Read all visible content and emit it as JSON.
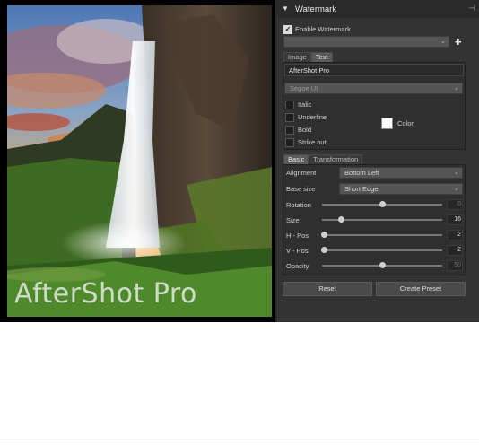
{
  "preview": {
    "watermark_text": "AfterShot Pro"
  },
  "panel": {
    "title": "Watermark",
    "enable_watermark_label": "Enable Watermark",
    "enable_watermark_checked": true,
    "preset_value": "",
    "add_label": "+",
    "tabs_top": [
      {
        "label": "Image"
      },
      {
        "label": "Text"
      }
    ],
    "text_value": "AfterShot Pro",
    "font_value": "Segoe UI",
    "styles": [
      {
        "label": "Italic",
        "checked": false
      },
      {
        "label": "Underline",
        "checked": false
      },
      {
        "label": "Bold",
        "checked": false
      },
      {
        "label": "Strike out",
        "checked": false
      }
    ],
    "color_label": "Color",
    "color_value": "#ffffff",
    "tabs_bottom": [
      {
        "label": "Basic"
      },
      {
        "label": "Transformation"
      }
    ],
    "alignment_label": "Alignment",
    "alignment_value": "Bottom Left",
    "base_size_label": "Base size",
    "base_size_value": "Short Edge",
    "sliders": [
      {
        "label": "Rotation",
        "value": "0",
        "fraction": 0.5,
        "dim": true
      },
      {
        "label": "Size",
        "value": "16",
        "fraction": 0.16,
        "dim": false
      },
      {
        "label": "H - Pos",
        "value": "2",
        "fraction": 0.02,
        "dim": false
      },
      {
        "label": "V - Pos",
        "value": "2",
        "fraction": 0.02,
        "dim": false
      },
      {
        "label": "Opacity",
        "value": "50",
        "fraction": 0.5,
        "dim": true
      }
    ],
    "reset_label": "Reset",
    "create_preset_label": "Create Preset"
  },
  "colors": {
    "panel_bg": "#333333",
    "header_bg": "#2a2a2a",
    "accent": "#dcdcdc"
  },
  "icons": {
    "collapse": "triangle-down-icon",
    "pin": "pin-icon",
    "grip": "splitter-grip-icon"
  }
}
